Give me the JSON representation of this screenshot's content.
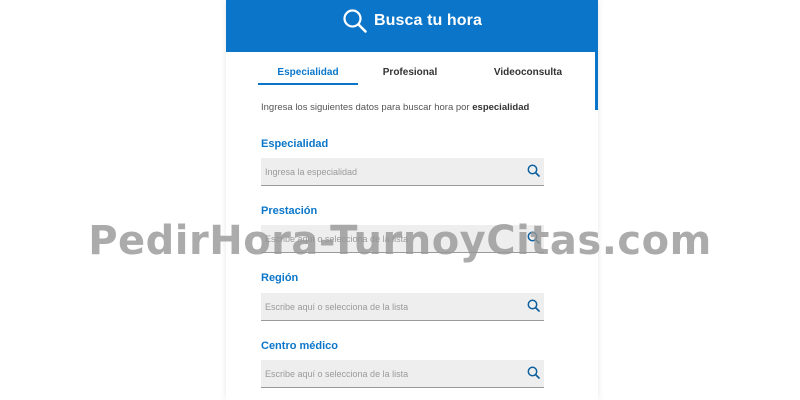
{
  "header": {
    "title": "Busca tu hora",
    "icon": "search-icon",
    "color": "#0b76c9"
  },
  "tabs": [
    {
      "label": "Especialidad",
      "active": true
    },
    {
      "label": "Profesional",
      "active": false
    },
    {
      "label": "Videoconsulta",
      "active": false
    }
  ],
  "intro": {
    "text": "Ingresa los siguientes datos para buscar hora por",
    "emphasis": "especialidad"
  },
  "fields": [
    {
      "label": "Especialidad",
      "placeholder": "Ingresa la especialidad"
    },
    {
      "label": "Prestación",
      "placeholder": "Escribe aquí o selecciona de la lista"
    },
    {
      "label": "Región",
      "placeholder": "Escribe aquí o selecciona de la lista"
    },
    {
      "label": "Centro médico",
      "placeholder": "Escribe aquí o selecciona de la lista"
    }
  ],
  "watermark": "PedirHora-TurnoyCitas.com"
}
